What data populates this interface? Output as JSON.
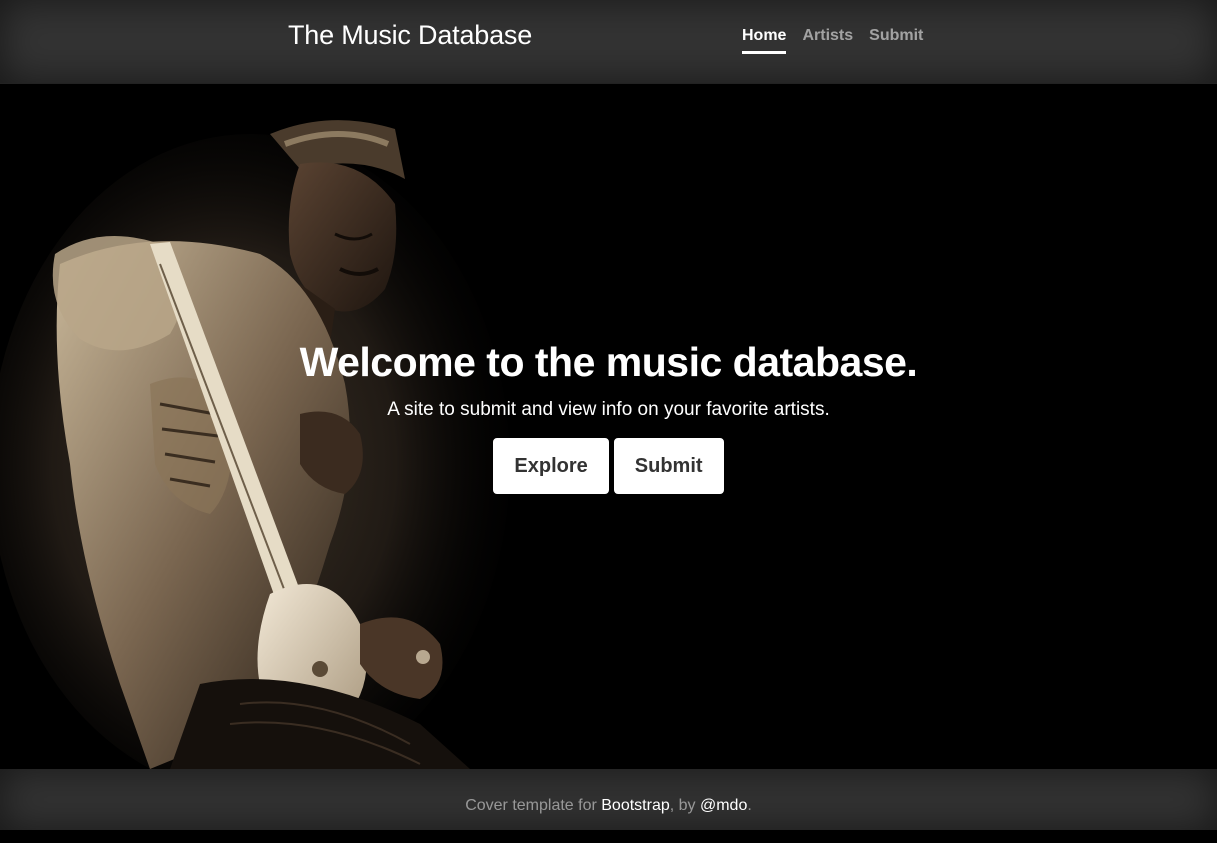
{
  "header": {
    "brand": "The Music Database",
    "nav": [
      {
        "label": "Home",
        "active": true
      },
      {
        "label": "Artists",
        "active": false
      },
      {
        "label": "Submit",
        "active": false
      }
    ]
  },
  "hero": {
    "heading": "Welcome to the music database.",
    "lead": "A site to submit and view info on your favorite artists.",
    "buttons": {
      "explore": "Explore",
      "submit": "Submit"
    },
    "photo_icon": "guitarist-photo"
  },
  "footer": {
    "prefix": "Cover template for ",
    "link1": "Bootstrap",
    "middle": ", by ",
    "link2": "@mdo",
    "suffix": "."
  },
  "colors": {
    "chrome": "#333333",
    "hero_bg": "#000000",
    "text": "#ffffff",
    "button_bg": "#ffffff",
    "button_text": "#333333"
  }
}
